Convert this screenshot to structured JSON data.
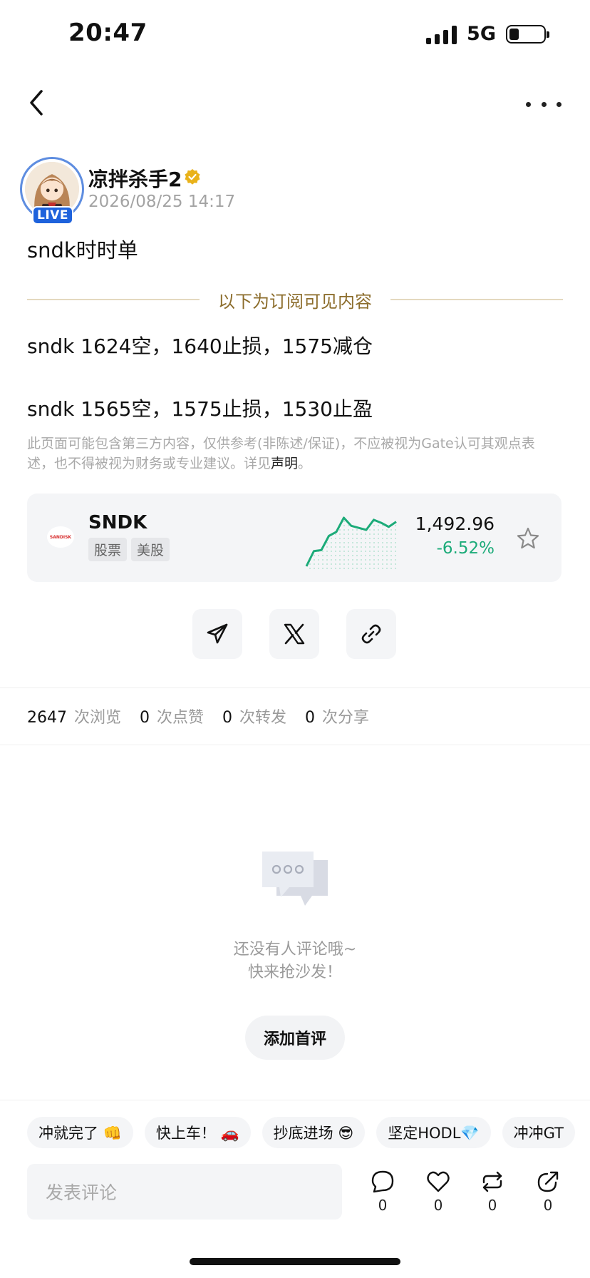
{
  "status_bar": {
    "time": "20:47",
    "network": "5G"
  },
  "author": {
    "name": "凉拌杀手2",
    "time": "2026/08/25 14:17",
    "live_badge": "LIVE"
  },
  "post": {
    "title": "sndk时时单",
    "subscription_divider": "以下为订阅可见内容",
    "lines": [
      "sndk 1624空，1640止损，1575减仓",
      "sndk 1565空，1575止损，1530止盈"
    ],
    "disclaimer": "此页面可能包含第三方内容，仅供参考(非陈述/保证)，不应被视为Gate认可其观点表述，也不得被视为财务或专业建议。详见",
    "disclaimer_link": "声明",
    "disclaimer_end": "。"
  },
  "stock": {
    "logo_text": "SANDISK",
    "symbol": "SNDK",
    "tags": [
      "股票",
      "美股"
    ],
    "price": "1,492.96",
    "change": "-6.52%",
    "change_color": "#1cab79",
    "sparkline": [
      1448,
      1463,
      1464,
      1478,
      1482,
      1496,
      1488,
      1486,
      1484,
      1494,
      1491,
      1487,
      1492
    ]
  },
  "share_icons": [
    "telegram-icon",
    "x-icon",
    "link-icon"
  ],
  "stats": [
    {
      "num": "2647",
      "label": "次浏览"
    },
    {
      "num": "0",
      "label": "次点赞"
    },
    {
      "num": "0",
      "label": "次转发"
    },
    {
      "num": "0",
      "label": "次分享"
    }
  ],
  "empty": {
    "line1": "还没有人评论哦~",
    "line2": "快来抢沙发！",
    "button": "添加首评"
  },
  "quick_replies": [
    "冲就完了 👊",
    "快上车！ 🚗",
    "抄底进场 😎",
    "坚定HODL💎",
    "冲冲GT"
  ],
  "bottom_bar": {
    "placeholder": "发表评论",
    "actions": [
      {
        "icon": "comment-icon",
        "count": "0"
      },
      {
        "icon": "heart-icon",
        "count": "0"
      },
      {
        "icon": "repost-icon",
        "count": "0"
      },
      {
        "icon": "share-icon",
        "count": "0"
      }
    ]
  }
}
